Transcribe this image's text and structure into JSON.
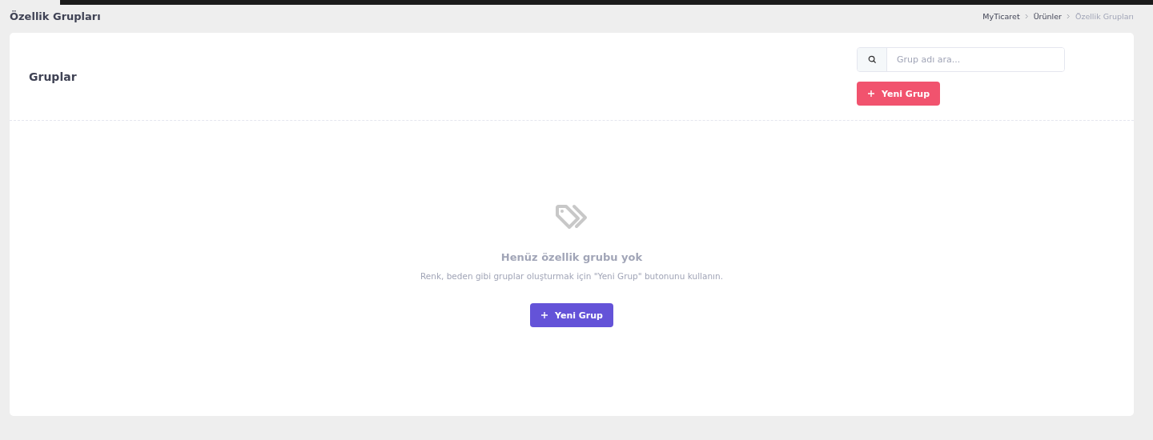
{
  "page_title": "Özellik Grupları",
  "breadcrumb": [
    {
      "label": "MyTicaret",
      "current": false
    },
    {
      "label": "Ürünler",
      "current": false
    },
    {
      "label": "Özellik Grupları",
      "current": true
    }
  ],
  "card": {
    "title": "Gruplar",
    "search": {
      "placeholder": "Grup adı ara..."
    },
    "new_button": "Yeni Grup"
  },
  "empty_state": {
    "title": "Henüz özellik grubu yok",
    "message": "Renk, beden gibi gruplar oluşturmak için \"Yeni Grup\" butonunu kullanın.",
    "button": "Yeni Grup"
  }
}
